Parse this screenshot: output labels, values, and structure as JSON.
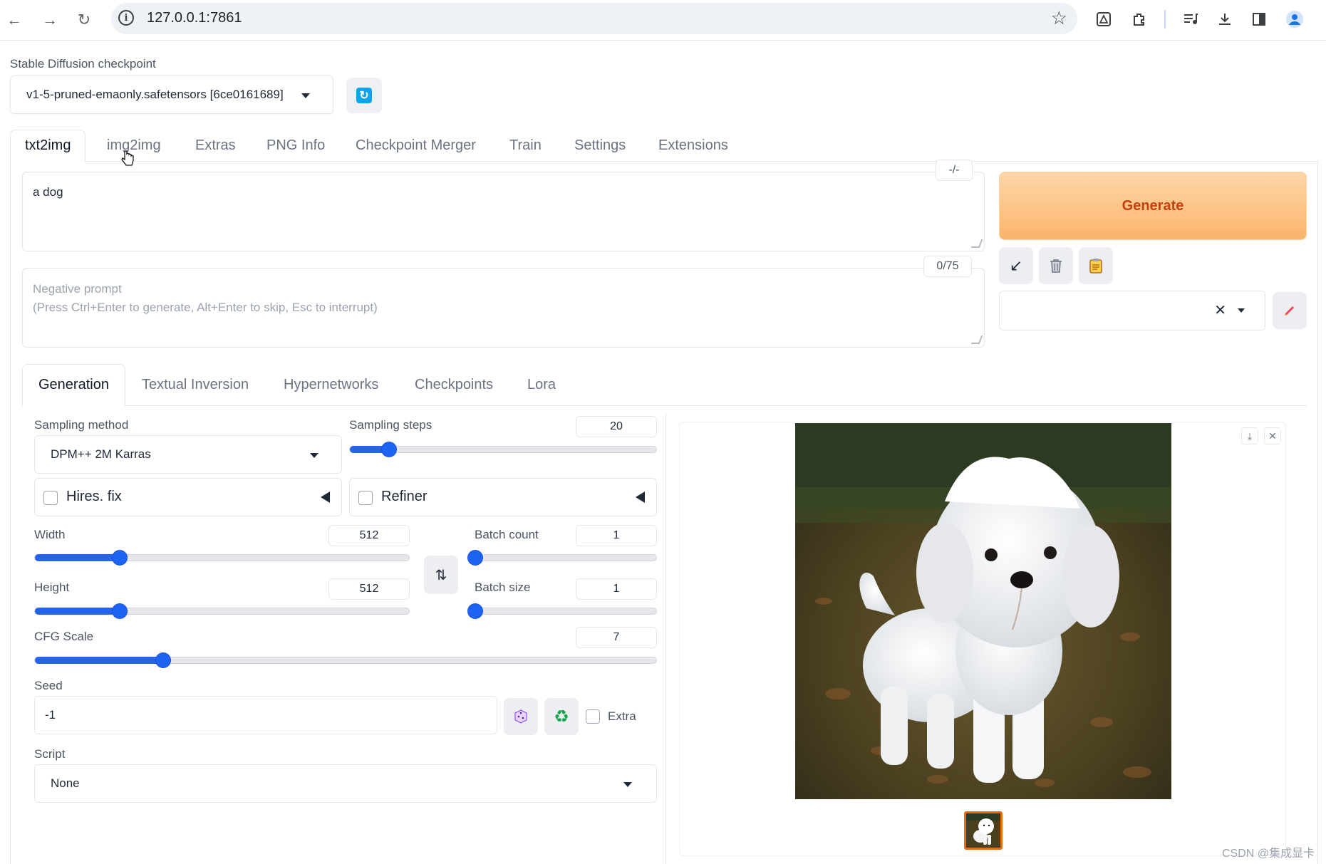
{
  "browser": {
    "url": "127.0.0.1:7861"
  },
  "checkpoint": {
    "label": "Stable Diffusion checkpoint",
    "value": "v1-5-pruned-emaonly.safetensors [6ce0161689]"
  },
  "main_tabs": [
    {
      "label": "txt2img",
      "active": true
    },
    {
      "label": "img2img"
    },
    {
      "label": "Extras"
    },
    {
      "label": "PNG Info"
    },
    {
      "label": "Checkpoint Merger"
    },
    {
      "label": "Train"
    },
    {
      "label": "Settings"
    },
    {
      "label": "Extensions"
    }
  ],
  "prompt": {
    "value": "a dog",
    "counter": "-/-"
  },
  "negative_prompt": {
    "placeholder": "Negative prompt\n(Press Ctrl+Enter to generate, Alt+Enter to skip, Esc to interrupt)",
    "counter": "0/75"
  },
  "actions": {
    "generate_label": "Generate",
    "read_icon": "arrow-down-left-icon",
    "trash_icon": "trash-icon",
    "clipboard_icon": "clipboard-icon",
    "edit_icon": "pencil-icon"
  },
  "sub_tabs": [
    {
      "label": "Generation",
      "active": true
    },
    {
      "label": "Textual Inversion"
    },
    {
      "label": "Hypernetworks"
    },
    {
      "label": "Checkpoints"
    },
    {
      "label": "Lora"
    }
  ],
  "generation": {
    "sampling_method": {
      "label": "Sampling method",
      "value": "DPM++ 2M Karras"
    },
    "sampling_steps": {
      "label": "Sampling steps",
      "value": "20",
      "min": 1,
      "max": 150,
      "level": 20
    },
    "hires_fix": {
      "label": "Hires. fix",
      "checked": false
    },
    "refiner": {
      "label": "Refiner",
      "checked": false
    },
    "width": {
      "label": "Width",
      "value": "512",
      "min": 64,
      "max": 2048,
      "level": 512
    },
    "height": {
      "label": "Height",
      "value": "512",
      "min": 64,
      "max": 2048,
      "level": 512
    },
    "batch_count": {
      "label": "Batch count",
      "value": "1",
      "min": 1,
      "max": 100,
      "level": 1
    },
    "batch_size": {
      "label": "Batch size",
      "value": "1",
      "min": 1,
      "max": 8,
      "level": 1
    },
    "cfg_scale": {
      "label": "CFG Scale",
      "value": "7",
      "min": 1,
      "max": 30,
      "level": 7
    },
    "seed": {
      "label": "Seed",
      "value": "-1",
      "extra_label": "Extra"
    },
    "script": {
      "label": "Script",
      "value": "None"
    }
  },
  "watermark": "CSDN @集成显卡",
  "colors": {
    "accent": "#1d64f2",
    "generate_text": "#c2410c",
    "thumb_border": "#ea6c0a"
  }
}
